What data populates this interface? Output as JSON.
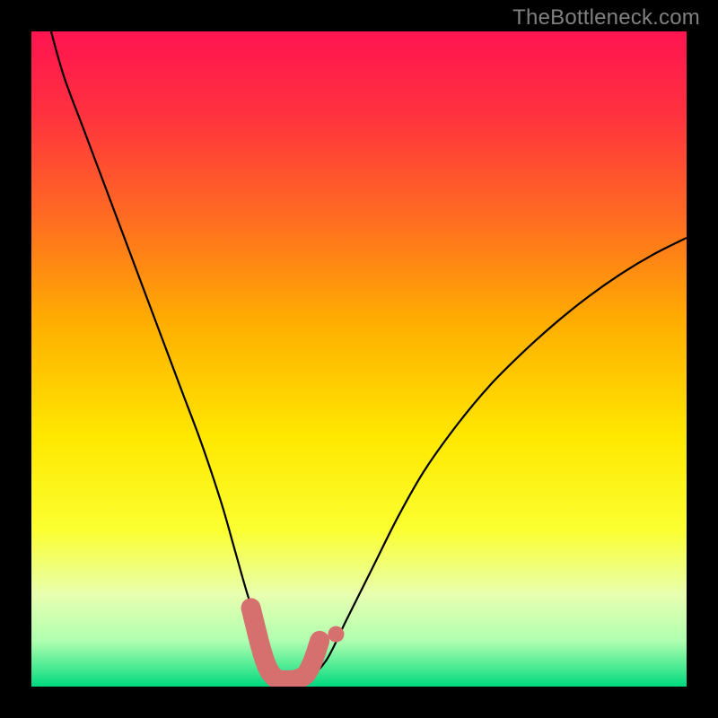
{
  "watermark": "TheBottleneck.com",
  "chart_data": {
    "type": "line",
    "title": "",
    "xlabel": "",
    "ylabel": "",
    "xlim": [
      0,
      100
    ],
    "ylim": [
      0,
      100
    ],
    "series": [
      {
        "name": "bottleneck-curve",
        "x": [
          3,
          5,
          8,
          11,
          14,
          17,
          20,
          23,
          26,
          29,
          31,
          33,
          35,
          36.5,
          38,
          40,
          42,
          45,
          48,
          52,
          56,
          60,
          65,
          70,
          75,
          80,
          85,
          90,
          95,
          100
        ],
        "y": [
          100,
          93,
          85,
          77,
          69,
          61,
          53,
          45,
          37,
          28,
          21,
          14,
          8,
          3,
          1,
          0.5,
          1,
          4,
          10,
          18,
          26,
          33,
          40,
          46,
          51,
          55.5,
          59.5,
          63,
          66,
          68.5
        ]
      }
    ],
    "highlight_segment": {
      "name": "optimal-range-marker",
      "x": [
        33.5,
        35,
        36,
        37,
        38,
        39,
        40,
        41,
        42,
        43,
        44
      ],
      "y": [
        12,
        6,
        3,
        1.5,
        1,
        1,
        1,
        1.3,
        2,
        4,
        7
      ],
      "color": "#d6706f"
    },
    "highlight_dot": {
      "x": 46.5,
      "y": 8,
      "color": "#d6706f"
    },
    "background_gradient": {
      "stops": [
        {
          "offset": 0.0,
          "color": "#ff1450"
        },
        {
          "offset": 0.12,
          "color": "#ff3040"
        },
        {
          "offset": 0.28,
          "color": "#ff6a22"
        },
        {
          "offset": 0.45,
          "color": "#ffb000"
        },
        {
          "offset": 0.62,
          "color": "#ffe800"
        },
        {
          "offset": 0.76,
          "color": "#fbff30"
        },
        {
          "offset": 0.86,
          "color": "#e8ffb0"
        },
        {
          "offset": 0.93,
          "color": "#b0ffb0"
        },
        {
          "offset": 0.975,
          "color": "#40e890"
        },
        {
          "offset": 1.0,
          "color": "#00d880"
        }
      ]
    }
  }
}
